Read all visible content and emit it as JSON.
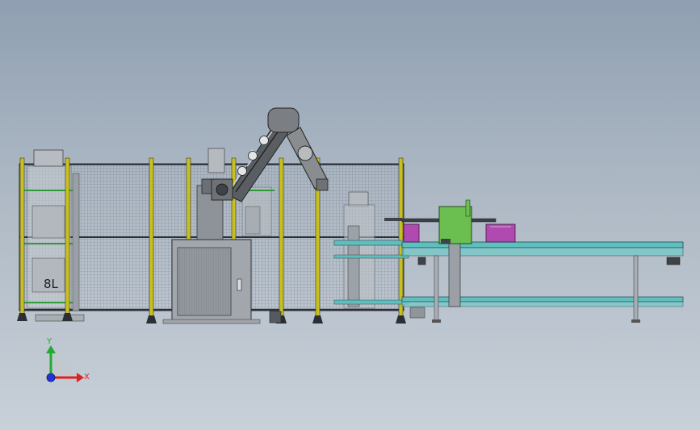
{
  "drawing": {
    "station_number": "8L"
  },
  "triad": {
    "y_label": "Y",
    "x_label": "X",
    "colors": {
      "y": "#22aa33",
      "x": "#dd2222",
      "z": "#2233dd"
    }
  },
  "colors": {
    "background_top": "#8f9fb1",
    "background_bottom": "#c8d0d8",
    "fence_post": "#c8c020",
    "mesh": "#3a3f45",
    "conveyor": "#5fbfbf",
    "lift_box": "#6abf50",
    "tote": "#b04ab0",
    "robot": "#8a8d90"
  }
}
